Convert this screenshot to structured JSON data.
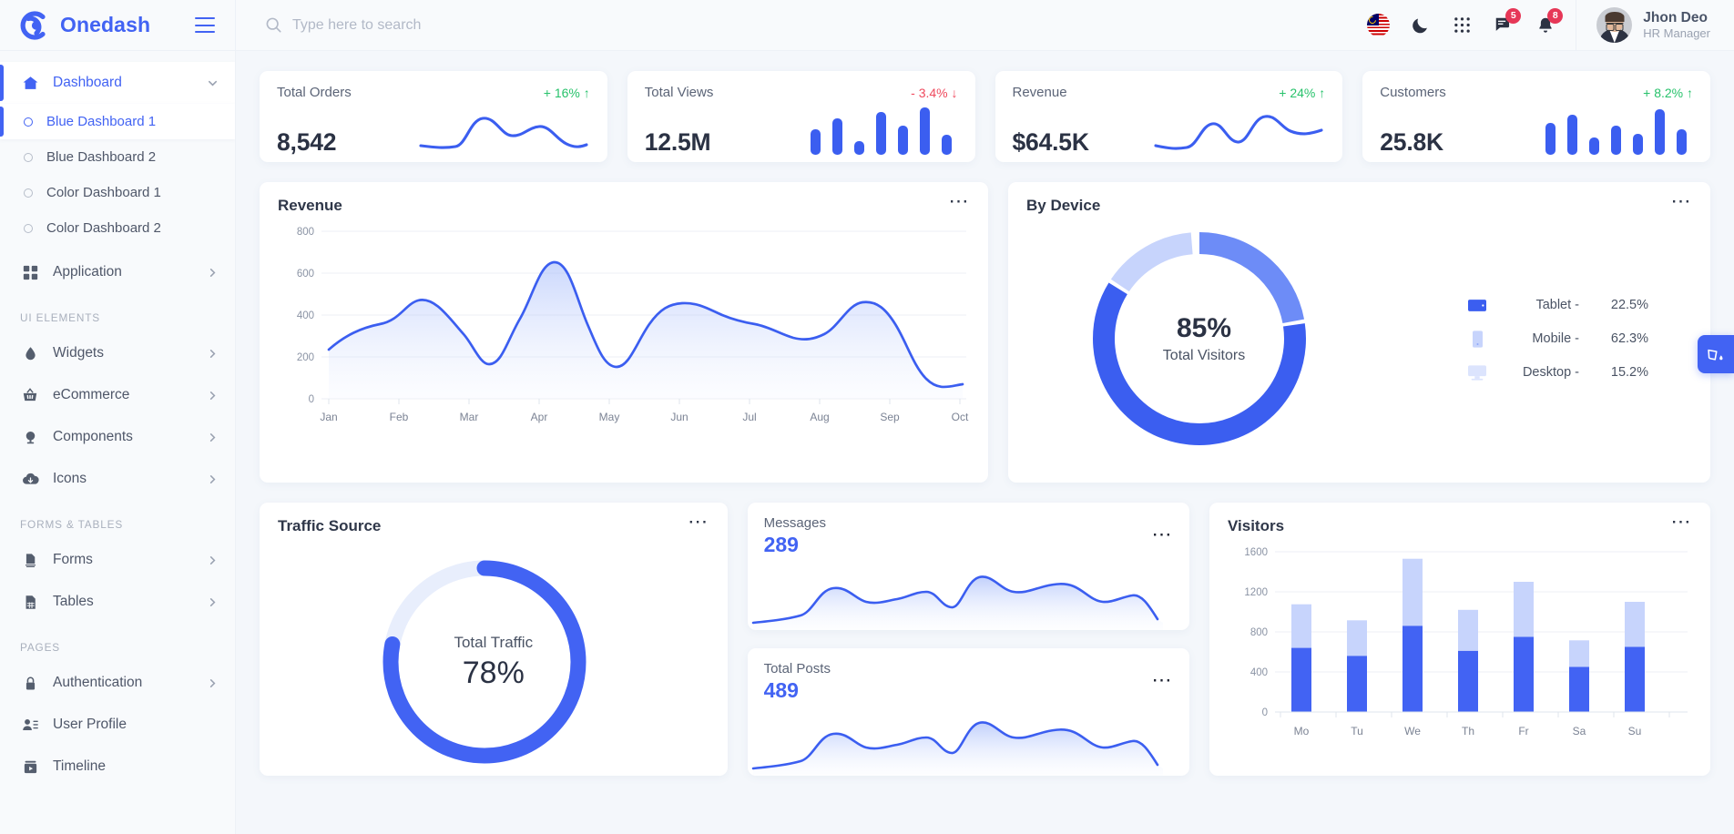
{
  "brand": {
    "name": "Onedash",
    "logo_icon": "onedash-swirl-logo",
    "menu_icon": "hamburger-menu-icon"
  },
  "search": {
    "placeholder": "Type here to search",
    "value": "",
    "icon": "search-icon"
  },
  "header": {
    "language_icon": "malaysia-flag-icon",
    "dark_mode_icon": "moon-icon",
    "apps_icon": "grid-apps-icon",
    "messages_icon": "message-icon",
    "messages_badge": "5",
    "notifications_icon": "bell-icon",
    "notifications_badge": "8",
    "user": {
      "name": "Jhon Deo",
      "role": "HR Manager",
      "avatar": "user-avatar"
    }
  },
  "sidebar": {
    "items": [
      {
        "label": "Dashboard",
        "icon": "home-icon",
        "active": true,
        "expanded": true
      },
      {
        "label": "Blue Dashboard 1",
        "icon": "radio-dot-icon",
        "active": true,
        "sub": true
      },
      {
        "label": "Blue Dashboard 2",
        "icon": "radio-dot-icon",
        "sub": true
      },
      {
        "label": "Color Dashboard 1",
        "icon": "radio-dot-icon",
        "sub": true
      },
      {
        "label": "Color Dashboard 2",
        "icon": "radio-dot-icon",
        "sub": true
      },
      {
        "label": "Application",
        "icon": "grid-squares-icon",
        "chevron": "chevron-right-icon"
      }
    ],
    "sections": [
      {
        "title": "UI ELEMENTS",
        "items": [
          {
            "label": "Widgets",
            "icon": "droplet-icon",
            "chevron": "chevron-right-icon"
          },
          {
            "label": "eCommerce",
            "icon": "basket-icon",
            "chevron": "chevron-right-icon"
          },
          {
            "label": "Components",
            "icon": "lamp-icon",
            "chevron": "chevron-right-icon"
          },
          {
            "label": "Icons",
            "icon": "cloud-download-icon",
            "chevron": "chevron-right-icon"
          }
        ]
      },
      {
        "title": "FORMS & TABLES",
        "items": [
          {
            "label": "Forms",
            "icon": "document-icon",
            "chevron": "chevron-right-icon"
          },
          {
            "label": "Tables",
            "icon": "table-icon",
            "chevron": "chevron-right-icon"
          }
        ]
      },
      {
        "title": "PAGES",
        "items": [
          {
            "label": "Authentication",
            "icon": "lock-icon",
            "chevron": "chevron-right-icon"
          },
          {
            "label": "User Profile",
            "icon": "user-card-icon"
          },
          {
            "label": "Timeline",
            "icon": "timeline-icon"
          }
        ]
      }
    ]
  },
  "stats": [
    {
      "title": "Total Orders",
      "value": "8,542",
      "delta": "+ 16% ↑",
      "direction": "up",
      "spark": "line"
    },
    {
      "title": "Total Views",
      "value": "12.5M",
      "delta": "- 3.4% ↓",
      "direction": "down",
      "spark": "bars"
    },
    {
      "title": "Revenue",
      "value": "$64.5K",
      "delta": "+ 24% ↑",
      "direction": "up",
      "spark": "line"
    },
    {
      "title": "Customers",
      "value": "25.8K",
      "delta": "+ 8.2% ↑",
      "direction": "up",
      "spark": "bars"
    }
  ],
  "revenue_card": {
    "title": "Revenue",
    "menu_icon": "more-options-icon"
  },
  "device_card": {
    "title": "By Device",
    "menu_icon": "more-options-icon",
    "center_value": "85%",
    "center_label": "Total Visitors",
    "legend": [
      {
        "icon": "tablet-icon",
        "label": "Tablet -",
        "value": "22.5%",
        "color": "#6d8cf7"
      },
      {
        "icon": "mobile-icon",
        "label": "Mobile -",
        "value": "62.3%",
        "color": "#3b5ef0"
      },
      {
        "icon": "desktop-icon",
        "label": "Desktop -",
        "value": "15.2%",
        "color": "#c7d4fc"
      }
    ]
  },
  "traffic_card": {
    "title": "Traffic Source",
    "menu_icon": "more-options-icon",
    "center_label": "Total Traffic",
    "center_value": "78%"
  },
  "messages_card": {
    "title": "Messages",
    "value": "289",
    "menu_icon": "more-options-icon"
  },
  "posts_card": {
    "title": "Total Posts",
    "value": "489",
    "menu_icon": "more-options-icon"
  },
  "visitors_card": {
    "title": "Visitors",
    "menu_icon": "more-options-icon"
  },
  "theme_fab": {
    "icon": "paint-bucket-icon"
  },
  "colors": {
    "accent": "#4263f3",
    "accent_mid": "#6d8cf7",
    "accent_light": "#c7d4fc",
    "up": "#27c26b",
    "down": "#ef4a5e",
    "badge": "#e63757"
  },
  "chart_data": [
    {
      "type": "area",
      "title": "Revenue",
      "categories": [
        "Jan",
        "Feb",
        "Mar",
        "Apr",
        "May",
        "Jun",
        "Jul",
        "Aug",
        "Sep",
        "Oct"
      ],
      "values": [
        235,
        450,
        165,
        650,
        155,
        450,
        390,
        305,
        455,
        110
      ],
      "xlabel": "",
      "ylabel": "",
      "ylim": [
        0,
        800
      ],
      "yticks": [
        0,
        200,
        400,
        600,
        800
      ],
      "grid": true,
      "legend": "none",
      "line_color": "#3b5ef0"
    },
    {
      "type": "pie",
      "title": "By Device",
      "labels": [
        "Tablet",
        "Mobile",
        "Desktop"
      ],
      "values": [
        22.5,
        62.3,
        15.2
      ],
      "colors": [
        "#6d8cf7",
        "#3b5ef0",
        "#c7d4fc"
      ],
      "center_text": "85%",
      "center_subtext": "Total Visitors",
      "legend": "right"
    },
    {
      "type": "pie",
      "title": "Traffic Source",
      "labels": [
        "Traffic",
        "Remaining"
      ],
      "values": [
        78,
        22
      ],
      "colors": [
        "#4263f3",
        "#e8eefc"
      ],
      "center_text": "78%",
      "center_subtext": "Total Traffic",
      "legend": "none"
    },
    {
      "type": "area",
      "title": "Messages",
      "values": [
        60,
        75,
        180,
        150,
        135,
        140,
        165,
        130,
        120,
        230,
        200,
        185,
        175,
        200,
        185,
        140,
        130,
        170,
        165,
        70
      ],
      "legend": "none",
      "line_color": "#3b5ef0"
    },
    {
      "type": "area",
      "title": "Total Posts",
      "values": [
        60,
        75,
        180,
        150,
        135,
        140,
        165,
        130,
        120,
        230,
        200,
        185,
        175,
        200,
        185,
        140,
        130,
        170,
        165,
        70
      ],
      "legend": "none",
      "line_color": "#3b5ef0"
    },
    {
      "type": "bar",
      "title": "Visitors",
      "categories": [
        "Mo",
        "Tu",
        "We",
        "Th",
        "Fr",
        "Sa",
        "Su"
      ],
      "series": [
        {
          "name": "lower",
          "values": [
            640,
            560,
            860,
            610,
            750,
            450,
            650
          ],
          "color": "#4263f3"
        },
        {
          "name": "upper",
          "values": [
            435,
            355,
            670,
            410,
            550,
            265,
            450
          ],
          "color": "#c7d4fc"
        }
      ],
      "totals": [
        1075,
        915,
        1530,
        1020,
        1300,
        715,
        1100
      ],
      "stacked": true,
      "ylim": [
        0,
        1600
      ],
      "yticks": [
        0,
        400,
        800,
        1200,
        1600
      ],
      "grid": true,
      "legend": "none"
    },
    {
      "type": "line",
      "title": "Total Orders sparkline",
      "values": [
        20,
        18,
        17,
        22,
        55,
        62,
        48,
        40,
        44,
        52,
        50,
        30
      ]
    },
    {
      "type": "bar",
      "title": "Total Views sparkline",
      "values": [
        30,
        42,
        16,
        50,
        34,
        55,
        24
      ]
    },
    {
      "type": "line",
      "title": "Revenue sparkline",
      "values": [
        20,
        18,
        20,
        30,
        50,
        38,
        28,
        40,
        58,
        50,
        44
      ]
    },
    {
      "type": "bar",
      "title": "Customers sparkline",
      "values": [
        36,
        48,
        20,
        42,
        28,
        52,
        34
      ]
    }
  ]
}
